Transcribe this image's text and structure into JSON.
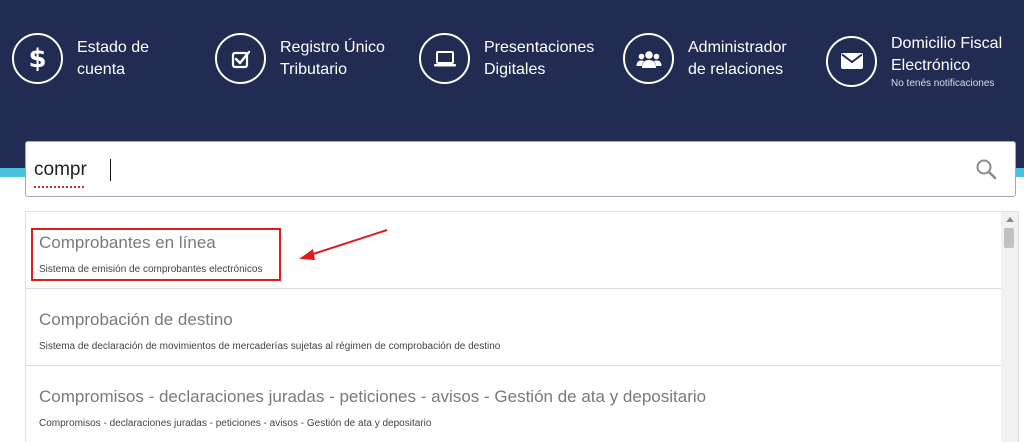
{
  "nav": {
    "items": [
      {
        "label": "Estado de cuenta",
        "icon": "dollar-icon"
      },
      {
        "label": "Registro Único Tributario",
        "icon": "checkbox-icon"
      },
      {
        "label": "Presentaciones Digitales",
        "icon": "laptop-icon"
      },
      {
        "label": "Administrador de relaciones",
        "icon": "people-icon"
      },
      {
        "label": "Domicilio Fiscal Electrónico",
        "sublabel": "No tenés notificaciones",
        "icon": "envelope-icon"
      }
    ]
  },
  "search": {
    "value": "compr",
    "icon": "search-icon"
  },
  "results": [
    {
      "title": "Comprobantes en línea",
      "description": "Sistema de emisión de comprobantes electrónicos"
    },
    {
      "title": "Comprobación de destino",
      "description": "Sistema de declaración de movimientos de mercaderías sujetas al régimen de comprobación de destino"
    },
    {
      "title": "Compromisos - declaraciones juradas - peticiones - avisos - Gestión de ata y depositario",
      "description": "Compromisos - declaraciones juradas - peticiones - avisos - Gestión de ata y depositario"
    }
  ],
  "colors": {
    "header_bg": "#222c52",
    "accent_strip": "#47c1db",
    "annotation_red": "#e01b1b"
  }
}
